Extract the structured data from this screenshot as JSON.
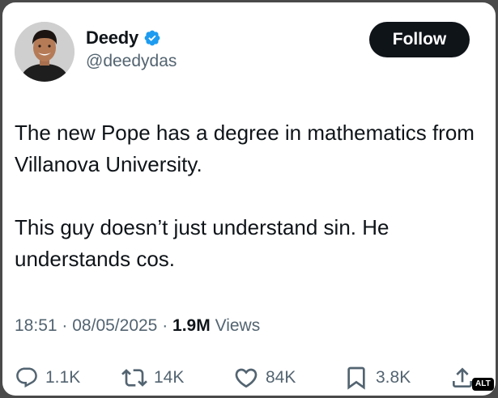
{
  "author": {
    "display_name": "Deedy",
    "handle": "@deedydas",
    "verified": true
  },
  "follow_label": "Follow",
  "tweet": {
    "paragraphs": [
      "The new Pope has a degree in mathematics from Villanova University.",
      "This guy doesn’t just understand sin. He understands cos."
    ]
  },
  "meta": {
    "time": "18:51",
    "separator": "·",
    "date": "08/05/2025",
    "views_count": "1.9M",
    "views_label": "Views"
  },
  "actions": {
    "replies": "1.1K",
    "reposts": "14K",
    "likes": "84K",
    "bookmarks": "3.8K",
    "alt_badge": "ALT"
  },
  "colors": {
    "text_primary": "#0f1419",
    "text_secondary": "#536471",
    "verified_blue": "#1d9bf0",
    "follow_bg": "#0f1419"
  },
  "icons": {
    "verified": "verified-badge-icon",
    "reply": "reply-icon",
    "repost": "repost-icon",
    "like": "heart-icon",
    "bookmark": "bookmark-icon",
    "share": "share-icon"
  }
}
